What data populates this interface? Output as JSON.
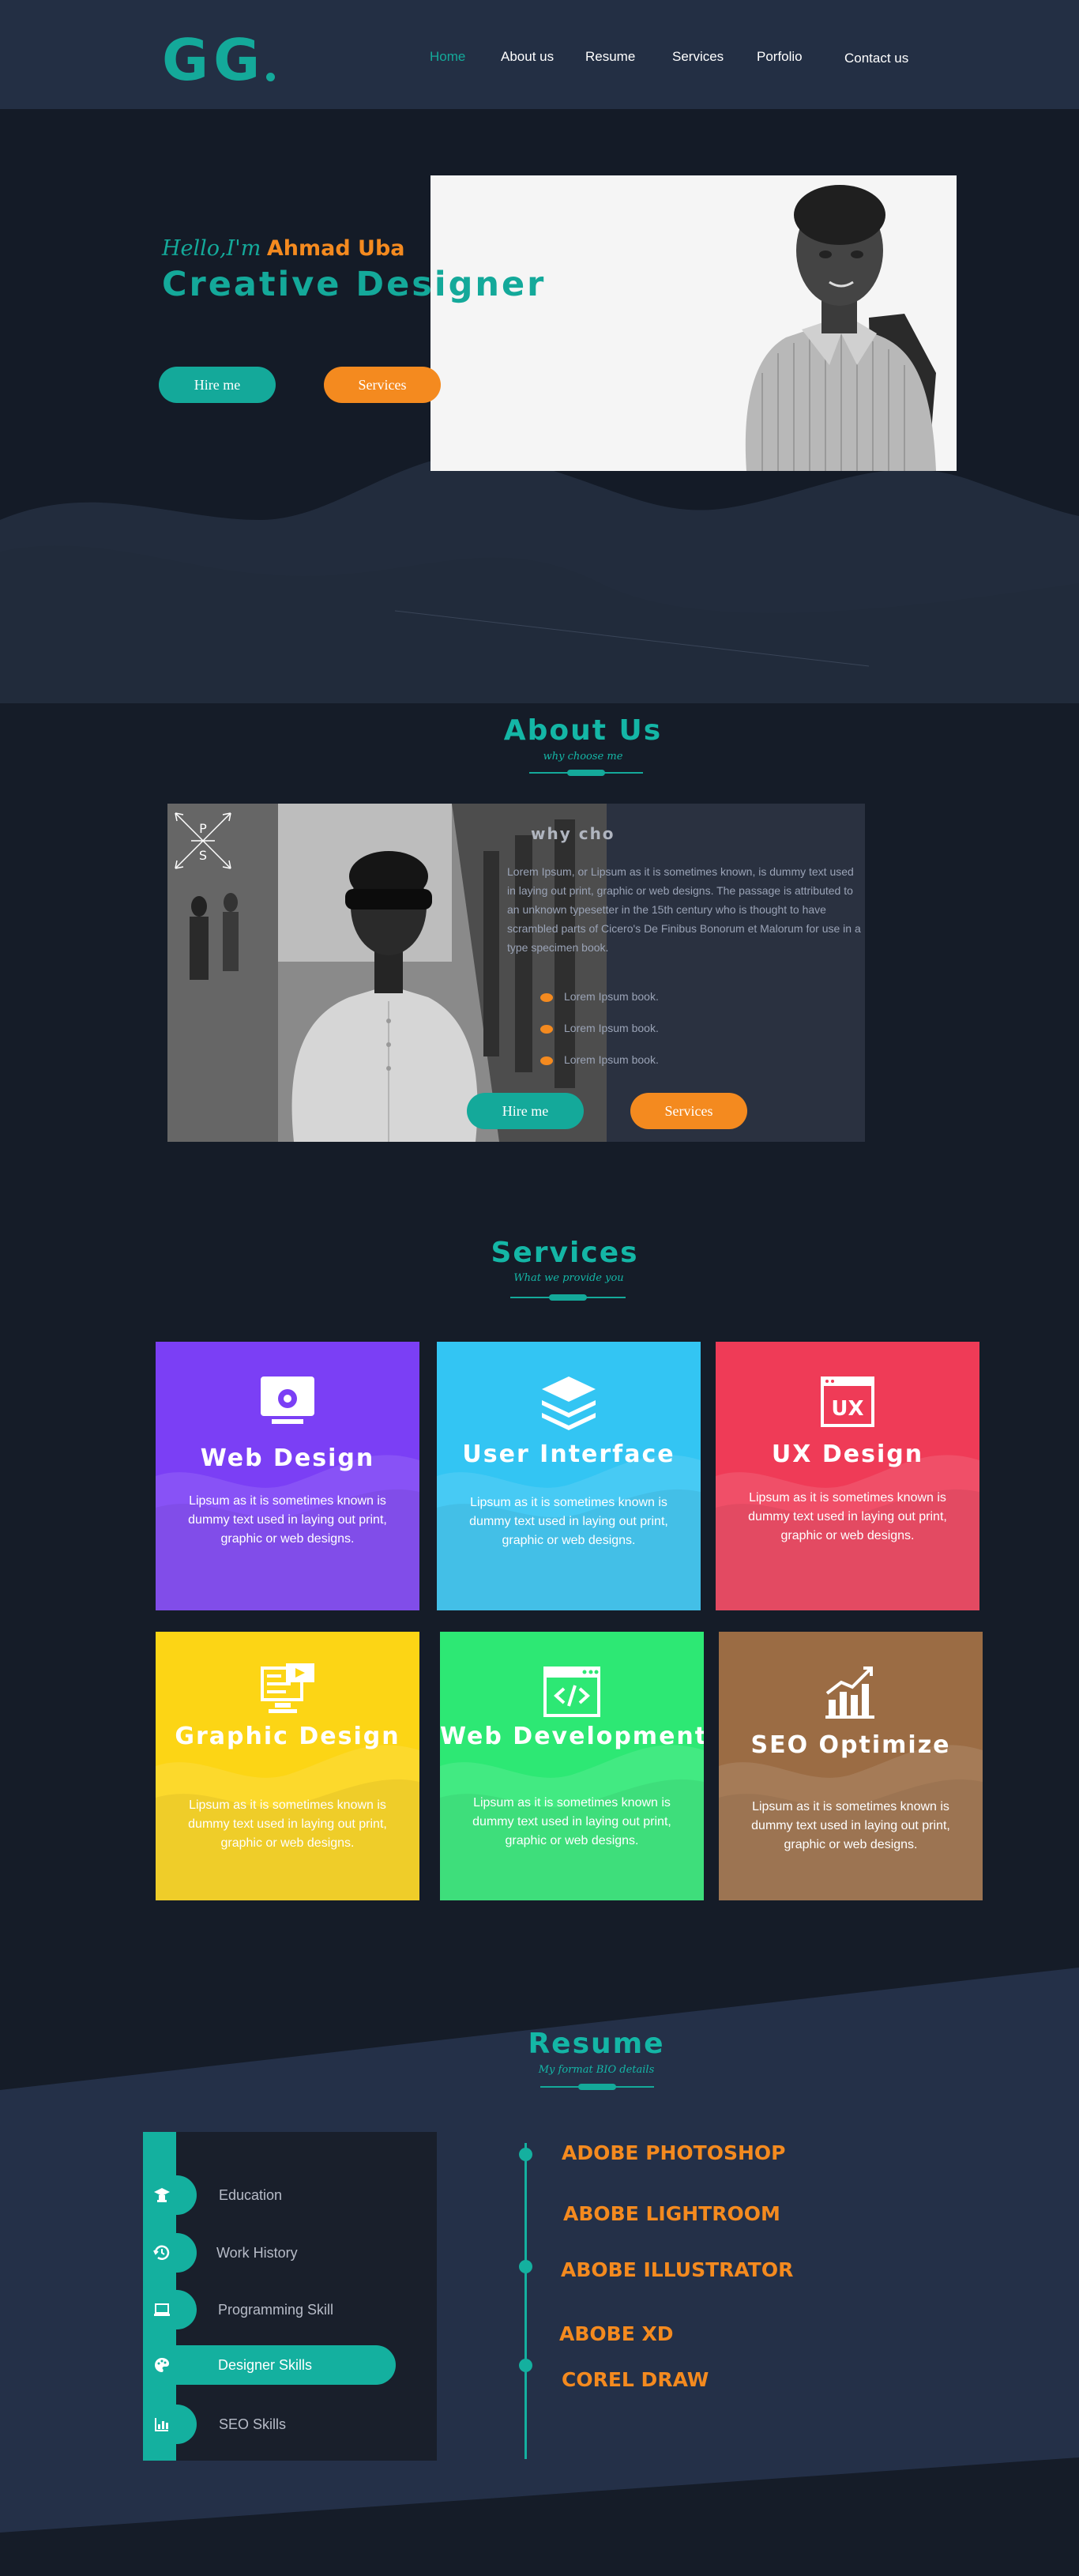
{
  "brand": {
    "logo_text": "GG",
    "accent": "#14a99a",
    "orange": "#f48a1f"
  },
  "nav": {
    "items": [
      {
        "label": "Home",
        "active": true
      },
      {
        "label": "About us"
      },
      {
        "label": "Resume"
      },
      {
        "label": "Services"
      },
      {
        "label": "Porfolio"
      },
      {
        "label": "Contact us"
      }
    ]
  },
  "hero": {
    "greeting": "Hello,I'm",
    "name": "Ahmad Uba",
    "role": "Creative Designer",
    "hire_label": "Hire me",
    "services_label": "Services"
  },
  "about": {
    "title": "About Us",
    "subtitle": "why choose me",
    "card_heading": "why cho",
    "badge_top": "P",
    "badge_bottom": "S",
    "paragraph": "Lorem Ipsum, or Lipsum as it is sometimes known, is dummy text used in laying out print, graphic or web designs. The passage is attributed to an unknown typesetter in the 15th century who is thought to have scrambled parts of Cicero's De Finibus Bonorum et Malorum for use in a type specimen book.",
    "bullets": [
      "Lorem Ipsum  book.",
      "Lorem Ipsum  book.",
      "Lorem Ipsum  book."
    ],
    "hire_label": "Hire me",
    "services_label": "Services"
  },
  "services": {
    "title": "Services",
    "subtitle": "What we provide you",
    "cards": [
      {
        "title": "Web Design",
        "desc": "Lipsum as it is sometimes known is dummy text used in laying out print,\ngraphic or web designs.",
        "color": "#7b3ff5",
        "icon": "monitor-gear-icon"
      },
      {
        "title": "User Interface",
        "desc": "Lipsum as it is sometimes known is dummy text used in laying out print,\ngraphic or web designs.",
        "color": "#33c5f3",
        "icon": "layers-icon"
      },
      {
        "title": "UX Design",
        "desc": "Lipsum as it is sometimes known is dummy text used in laying out print,\ngraphic or web designs.",
        "color": "#ef3b57",
        "icon": "ux-window-icon"
      },
      {
        "title": "Graphic Design",
        "desc": "Lipsum as it is sometimes known is dummy text used in laying out print,\ngraphic or web designs.",
        "color": "#fcd515",
        "icon": "graphic-monitor-icon"
      },
      {
        "title": "Web Development",
        "desc": "Lipsum as it is sometimes known is dummy text used in laying out print,\ngraphic or web designs.",
        "color": "#2de874",
        "icon": "code-window-icon"
      },
      {
        "title": "SEO Optimize",
        "desc": "Lipsum as it is sometimes known is dummy text used in laying out print,\ngraphic or web designs.",
        "color": "#9b6c44",
        "icon": "growth-chart-icon"
      }
    ]
  },
  "resume": {
    "title": "Resume",
    "subtitle": "My format BIO details",
    "menu": [
      {
        "label": "Education",
        "icon": "graduate-icon"
      },
      {
        "label": "Work History",
        "icon": "history-icon"
      },
      {
        "label": "Programming Skill",
        "icon": "laptop-icon"
      },
      {
        "label": "Designer Skills",
        "icon": "palette-icon",
        "active": true
      },
      {
        "label": "SEO Skills",
        "icon": "bar-chart-icon"
      }
    ],
    "skills": [
      "ADOBE PHOTOSHOP",
      "ABOBE LIGHTROOM",
      "ABOBE ILLUSTRATOR",
      "ABOBE XD",
      "COREL DRAW"
    ]
  }
}
